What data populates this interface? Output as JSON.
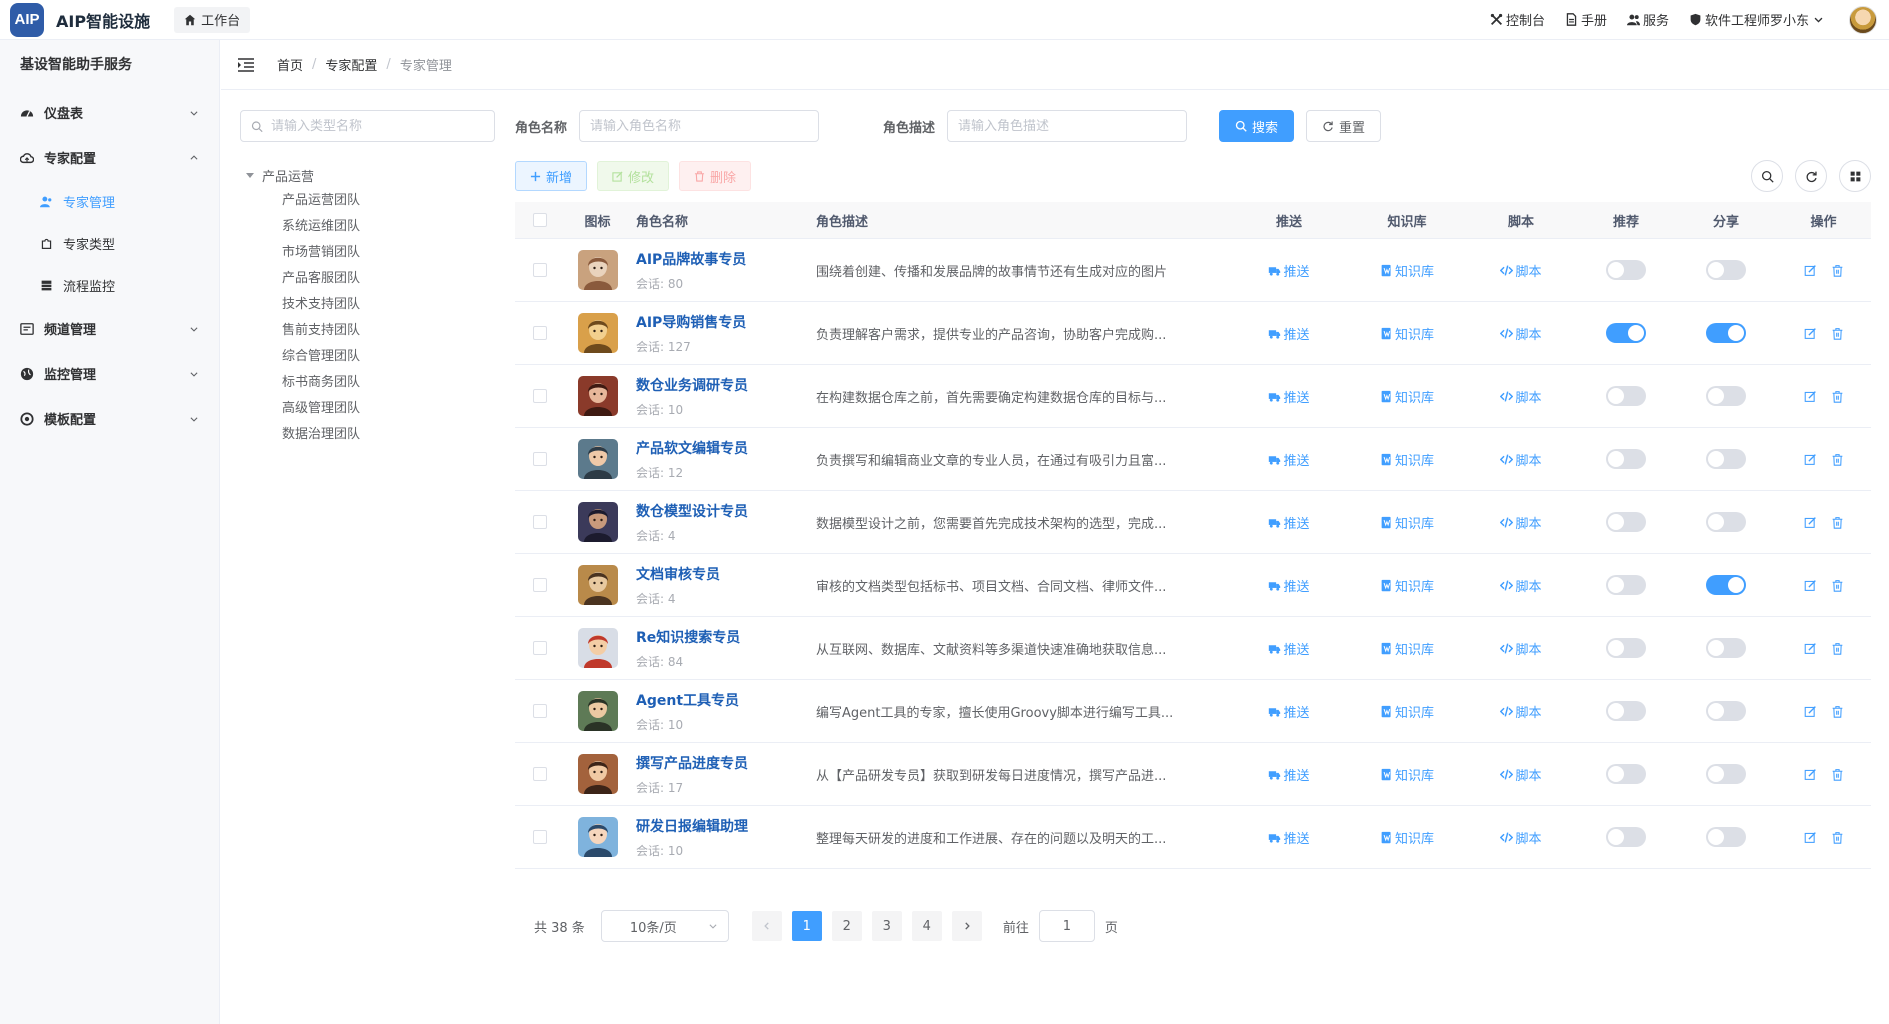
{
  "app": {
    "logo_text": "AIP",
    "title": "AIP智能设施",
    "home_tab": "工作台"
  },
  "topnav": {
    "console": "控制台",
    "manual": "手册",
    "service": "服务",
    "user": "软件工程师罗小东"
  },
  "sidebar": {
    "title": "基设智能助手服务",
    "menus": [
      {
        "label": "仪盘表",
        "icon": "dashboard-icon",
        "expanded": false
      },
      {
        "label": "专家配置",
        "icon": "cloud-icon",
        "expanded": true,
        "children": [
          {
            "label": "专家管理",
            "icon": "users-icon",
            "active": true
          },
          {
            "label": "专家类型",
            "icon": "puzzle-icon",
            "active": false
          },
          {
            "label": "流程监控",
            "icon": "database-icon",
            "active": false
          }
        ]
      },
      {
        "label": "频道管理",
        "icon": "channel-icon",
        "expanded": false
      },
      {
        "label": "监控管理",
        "icon": "globe-icon",
        "expanded": false
      },
      {
        "label": "模板配置",
        "icon": "template-icon",
        "expanded": false
      }
    ]
  },
  "breadcrumb": [
    "首页",
    "专家配置",
    "专家管理"
  ],
  "tree": {
    "search_placeholder": "请输入类型名称",
    "root": "产品运营",
    "children": [
      "产品运营团队",
      "系统运维团队",
      "市场营销团队",
      "产品客服团队",
      "技术支持团队",
      "售前支持团队",
      "综合管理团队",
      "标书商务团队",
      "高级管理团队",
      "数据治理团队"
    ]
  },
  "search": {
    "role_name_label": "角色名称",
    "role_name_placeholder": "请输入角色名称",
    "role_desc_label": "角色描述",
    "role_desc_placeholder": "请输入角色描述",
    "search_btn": "搜索",
    "reset_btn": "重置"
  },
  "toolbar": {
    "add": "新增",
    "edit": "修改",
    "delete": "删除"
  },
  "table": {
    "headers": {
      "icon": "图标",
      "name": "角色名称",
      "desc": "角色描述",
      "push": "推送",
      "kb": "知识库",
      "script": "脚本",
      "recommend": "推荐",
      "share": "分享",
      "ops": "操作"
    },
    "session_prefix": "会话: ",
    "push_label": "推送",
    "kb_label": "知识库",
    "script_label": "脚本",
    "rows": [
      {
        "name": "AIP品牌故事专员",
        "sessions": "会话: 80",
        "desc": "围绕着创建、传播和发展品牌的故事情节还有生成对应的图片",
        "recommend": false,
        "share": false,
        "avatar": [
          "#c9a27e",
          "#8a5a3c",
          "#e9d3bd"
        ]
      },
      {
        "name": "AIP导购销售专员",
        "sessions": "会话: 127",
        "desc": "负责理解客户需求，提供专业的产品咨询，协助客户完成购...",
        "recommend": true,
        "share": true,
        "avatar": [
          "#d9a04a",
          "#6e4a1c",
          "#f2cf8e"
        ]
      },
      {
        "name": "数仓业务调研专员",
        "sessions": "会话: 10",
        "desc": "在构建数据仓库之前，首先需要确定构建数据仓库的目标与...",
        "recommend": false,
        "share": false,
        "avatar": [
          "#8a3a2a",
          "#3e1a12",
          "#e7b79a"
        ]
      },
      {
        "name": "产品软文编辑专员",
        "sessions": "会话: 12",
        "desc": "负责撰写和编辑商业文章的专业人员，在通过有吸引力且富...",
        "recommend": false,
        "share": false,
        "avatar": [
          "#5c7a8c",
          "#2d3b46",
          "#efc9a8"
        ]
      },
      {
        "name": "数仓模型设计专员",
        "sessions": "会话: 4",
        "desc": "数据模型设计之前，您需要首先完成技术架构的选型，完成...",
        "recommend": false,
        "share": false,
        "avatar": [
          "#3b3a5a",
          "#1c1b2e",
          "#c89a7c"
        ]
      },
      {
        "name": "文档审核专员",
        "sessions": "会话: 4",
        "desc": "审核的文档类型包括标书、项目文档、合同文档、律师文件...",
        "recommend": false,
        "share": true,
        "avatar": [
          "#b98a4a",
          "#4a3320",
          "#e8c9a0"
        ]
      },
      {
        "name": "Re知识搜索专员",
        "sessions": "会话: 84",
        "desc": "从互联网、数据库、文献资料等多渠道快速准确地获取信息...",
        "recommend": false,
        "share": false,
        "avatar": [
          "#d8dde6",
          "#c0392b",
          "#f3cda5"
        ]
      },
      {
        "name": "Agent工具专员",
        "sessions": "会话: 10",
        "desc": "编写Agent工具的专家，擅长使用Groovy脚本进行编写工具...",
        "recommend": false,
        "share": false,
        "avatar": [
          "#5e7a56",
          "#2a3326",
          "#ecc9a2"
        ]
      },
      {
        "name": "撰写产品进度专员",
        "sessions": "会话: 17",
        "desc": "从【产品研发专员】获取到研发每日进度情况，撰写产品进...",
        "recommend": false,
        "share": false,
        "avatar": [
          "#a3623c",
          "#3c2418",
          "#f0c9a3"
        ]
      },
      {
        "name": "研发日报编辑助理",
        "sessions": "会话: 10",
        "desc": "整理每天研发的进度和工作进展、存在的问题以及明天的工...",
        "recommend": false,
        "share": false,
        "avatar": [
          "#7fb3dd",
          "#2b4a6b",
          "#f6d6bd"
        ]
      }
    ]
  },
  "pagination": {
    "total": "共 38 条",
    "page_size": "10条/页",
    "pages": [
      "1",
      "2",
      "3",
      "4"
    ],
    "current": "1",
    "goto_label": "前往",
    "goto_value": "1",
    "goto_suffix": "页"
  },
  "colors": {
    "primary": "#409eff",
    "link": "#1e5fb5",
    "logo_bg": "#2f5ca8"
  }
}
